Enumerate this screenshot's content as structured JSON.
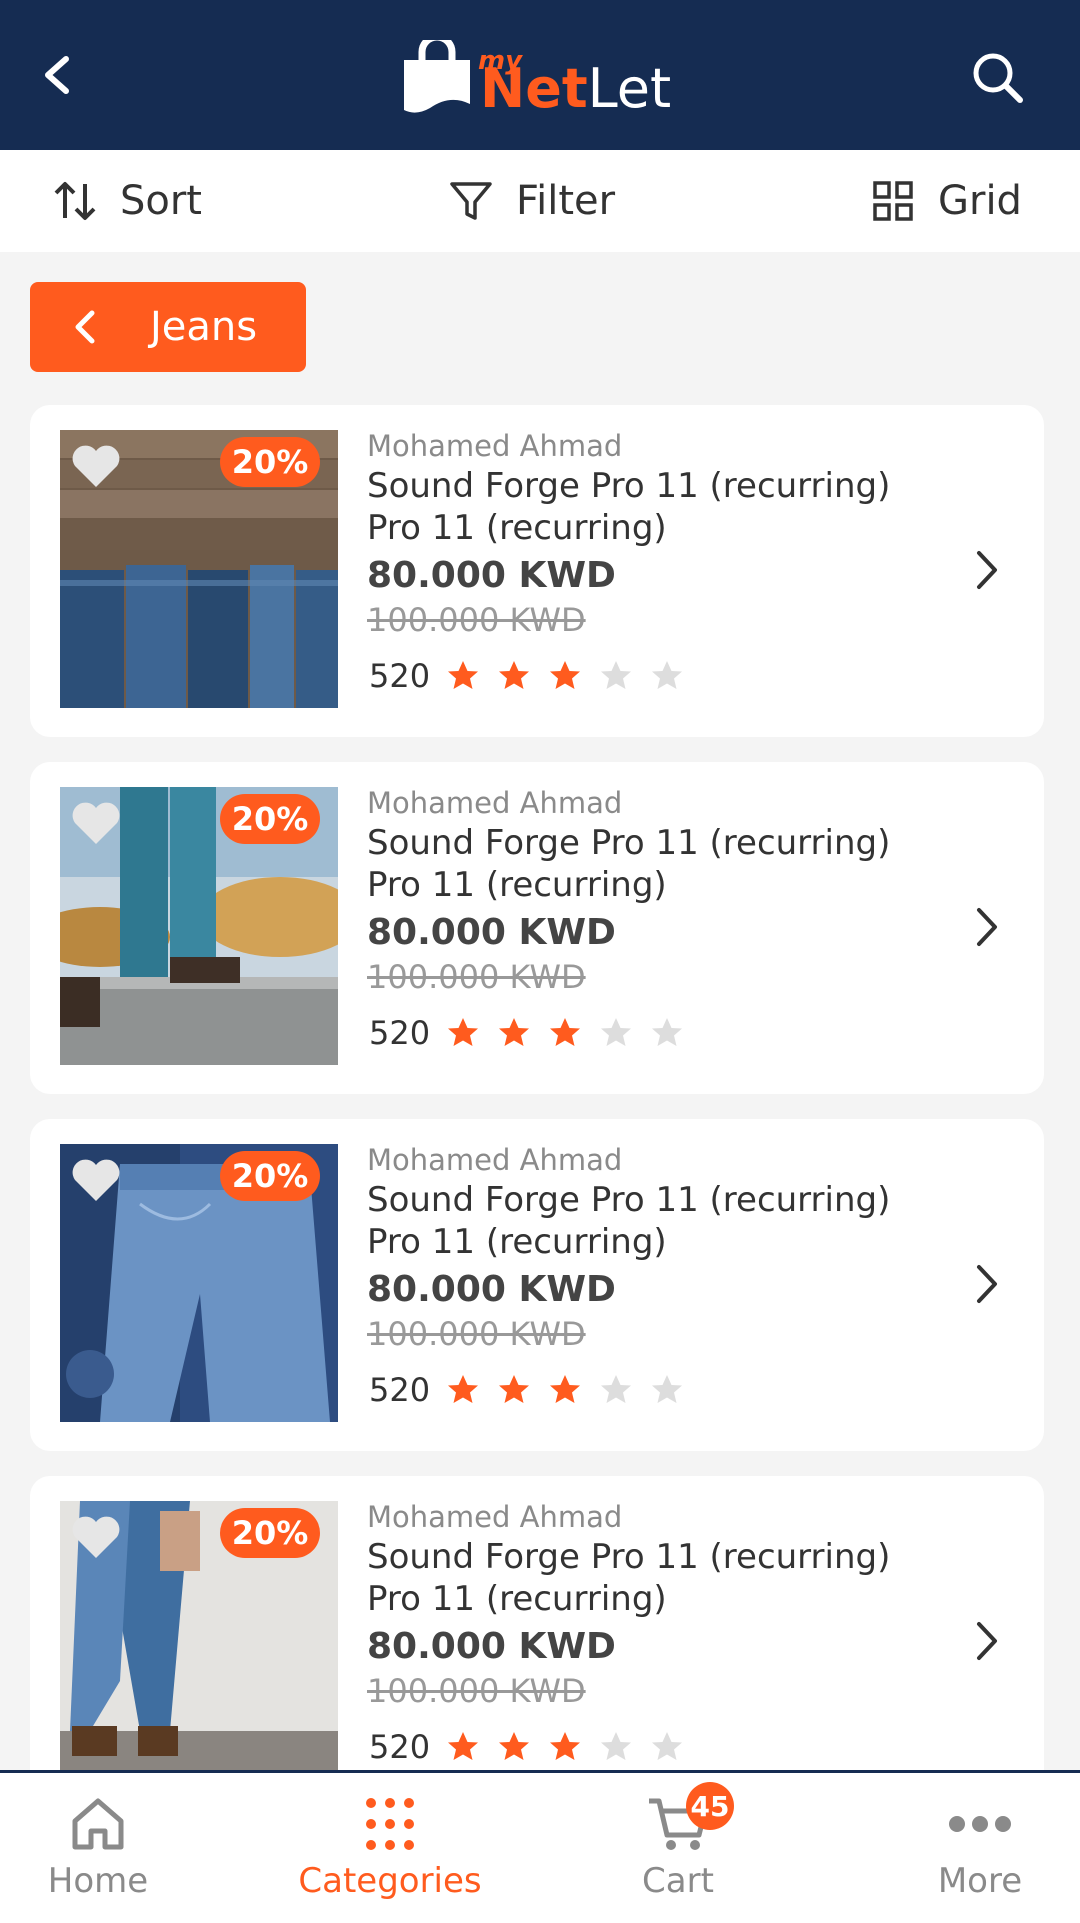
{
  "header": {
    "logo_prefix": "my",
    "logo_net": "Net",
    "logo_let": "Let"
  },
  "toolbar": {
    "sort_label": "Sort",
    "filter_label": "Filter",
    "grid_label": "Grid"
  },
  "category": {
    "label": "Jeans"
  },
  "products": [
    {
      "discount": "20%",
      "seller": "Mohamed Ahmad",
      "title_line1": "Sound Forge Pro 11 (recurring)",
      "title_line2": "Pro 11 (recurring)",
      "price": "80.000 KWD",
      "old_price": "100.000 KWD",
      "review_count": "520",
      "rating": 3,
      "rating_max": 5
    },
    {
      "discount": "20%",
      "seller": "Mohamed Ahmad",
      "title_line1": "Sound Forge Pro 11 (recurring)",
      "title_line2": "Pro 11 (recurring)",
      "price": "80.000 KWD",
      "old_price": "100.000 KWD",
      "review_count": "520",
      "rating": 3,
      "rating_max": 5
    },
    {
      "discount": "20%",
      "seller": "Mohamed Ahmad",
      "title_line1": "Sound Forge Pro 11 (recurring)",
      "title_line2": "Pro 11 (recurring)",
      "price": "80.000 KWD",
      "old_price": "100.000 KWD",
      "review_count": "520",
      "rating": 3,
      "rating_max": 5
    },
    {
      "discount": "20%",
      "seller": "Mohamed Ahmad",
      "title_line1": "Sound Forge Pro 11 (recurring)",
      "title_line2": "Pro 11 (recurring)",
      "price": "80.000 KWD",
      "old_price": "100.000 KWD",
      "review_count": "520",
      "rating": 3,
      "rating_max": 5
    }
  ],
  "tabbar": {
    "home_label": "Home",
    "categories_label": "Categories",
    "cart_label": "Cart",
    "cart_count": "45",
    "more_label": "More"
  },
  "colors": {
    "header_bg": "#152c52",
    "accent": "#ff5b1e",
    "star_empty": "#dddddd"
  }
}
